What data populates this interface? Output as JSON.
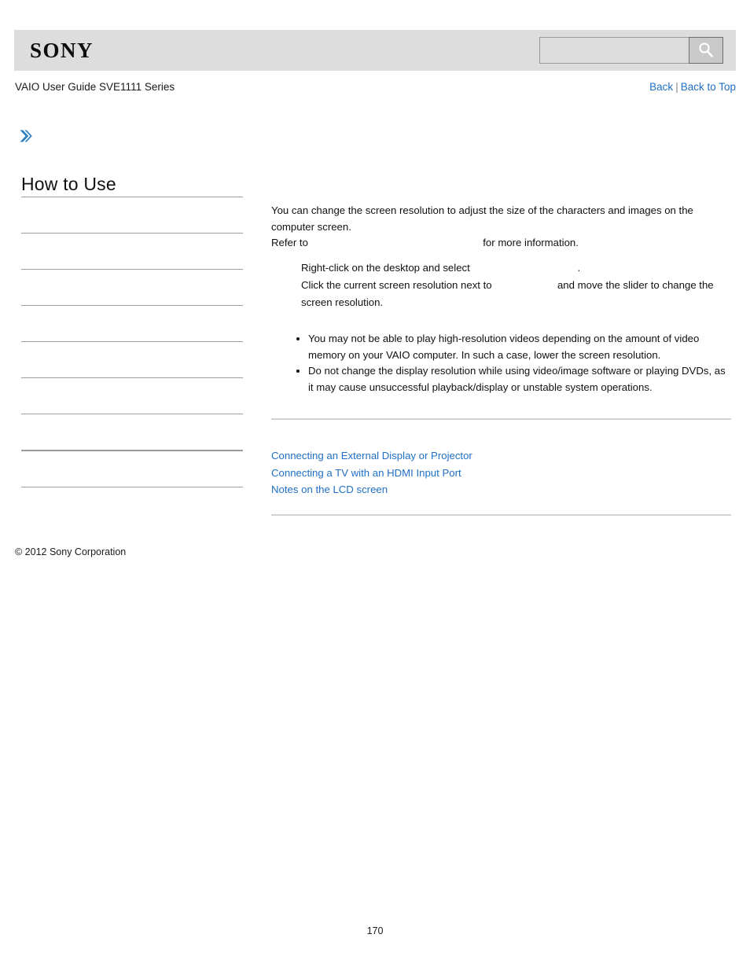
{
  "header": {
    "logo_text": "SONY",
    "search": {
      "value": "",
      "placeholder": "",
      "icon": "search-icon"
    }
  },
  "nav": {
    "guide_title": "VAIO User Guide SVE1111 Series",
    "back_label": "Back",
    "separator": "|",
    "back_to_top_label": "Back to Top"
  },
  "sidebar": {
    "expand_icon": "chevron-right-double-icon",
    "heading": "How to Use",
    "items": [
      {
        "label": ""
      },
      {
        "label": ""
      },
      {
        "label": ""
      },
      {
        "label": ""
      },
      {
        "label": ""
      },
      {
        "label": ""
      },
      {
        "label": ""
      },
      {
        "label": ""
      },
      {
        "label": ""
      }
    ]
  },
  "content": {
    "intro": "You can change the screen resolution to adjust the size of the characters and images on the computer screen.",
    "refer_prefix": "Refer to",
    "refer_suffix": "for more information.",
    "steps": [
      {
        "before": "Right-click on the desktop and select",
        "after": "."
      },
      {
        "before": "Click the current screen resolution next to",
        "after": "and move the slider to change the screen resolution."
      }
    ],
    "notes": [
      "You may not be able to play high-resolution videos depending on the amount of video memory on your VAIO computer. In such a case, lower the screen resolution.",
      "Do not change the display resolution while using video/image software or playing DVDs, as it may cause unsuccessful playback/display or unstable system operations."
    ]
  },
  "related_topics": [
    "Connecting an External Display or Projector",
    "Connecting a TV with an HDMI Input Port",
    "Notes on the LCD screen"
  ],
  "footer": {
    "copyright": "© 2012 Sony Corporation",
    "page_number": "170"
  },
  "colors": {
    "link": "#1f6fc4",
    "header_bg": "#dddddd",
    "rule": "#9e9e9e",
    "accent_arrow": "#2a7fc2"
  }
}
